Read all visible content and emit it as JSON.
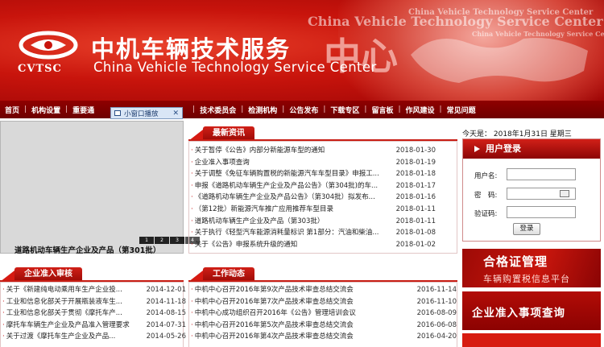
{
  "banner": {
    "logo_text": "CVTSC",
    "cn_title": "中机车辆技术服务",
    "big_char": "中心",
    "en_title": "China Vehicle Technology Service Center",
    "ghost_1": "China Vehicle Technology Service Center",
    "ghost_2": "China Vehicle Technology Service Center",
    "ghost_3": "China Vehicle Technology Service Center"
  },
  "nav": {
    "items_left": [
      "首页",
      "机构设置",
      "重要通"
    ],
    "items_right": [
      "技术委员会",
      "检测机构",
      "公告发布",
      "下载专区",
      "留言板",
      "作风建设",
      "常见问题"
    ]
  },
  "popup": {
    "label": "小窗口播放",
    "close": "✕"
  },
  "slideshow": {
    "caption": "道路机动车辆生产企业及产品（第301批）",
    "pages": [
      "1",
      "2",
      "3",
      "4"
    ]
  },
  "latest": {
    "title": "最新资讯",
    "items": [
      {
        "t": "关于暂停《公告》内部分新能源车型的通知",
        "d": "2018-01-30"
      },
      {
        "t": "企业准入事项查询",
        "d": "2018-01-19"
      },
      {
        "t": "关于调整《免征车辆购置税的新能源汽车车型目录》申报工...",
        "d": "2018-01-18"
      },
      {
        "t": "申报《道路机动车辆生产企业及产品公告》（第304批)的车...",
        "d": "2018-01-17"
      },
      {
        "t": "《道路机动车辆生产企业及产品公告》（第304批）拟发布...",
        "d": "2018-01-16"
      },
      {
        "t": "（第12批）新能源汽车推广应用推荐车型目录",
        "d": "2018-01-11"
      },
      {
        "t": "道路机动车辆生产企业及产品（第303批）",
        "d": "2018-01-11"
      },
      {
        "t": "关于执行《轻型汽车能源消耗量标识 第1部分：汽油和柴油...",
        "d": "2018-01-08"
      },
      {
        "t": "关于《公告》申报系统升级的通知",
        "d": "2018-01-02"
      }
    ]
  },
  "access": {
    "title": "企业准入审核",
    "items": [
      {
        "t": "关于《新建纯电动乘用车生产企业投...",
        "d": "2014-12-01"
      },
      {
        "t": "工业和信息化部关于开展瓶装液车生...",
        "d": "2014-11-18"
      },
      {
        "t": "工业和信息化部关于贯彻《摩托车产...",
        "d": "2014-08-15"
      },
      {
        "t": "摩托车车辆生产企业及产品准入管理要求",
        "d": "2014-07-31"
      },
      {
        "t": "关于过渡《摩托车生产企业及产品...",
        "d": "2014-05-26"
      }
    ]
  },
  "work": {
    "title": "工作动态",
    "items": [
      {
        "t": "中机中心召开2016年第9次产品技术审查总结交流会",
        "d": "2016-11-14"
      },
      {
        "t": "中机中心召开2016年第7次产品技术审查总结交流会",
        "d": "2016-11-10"
      },
      {
        "t": "中机中心成功组织召开2016年《公告》管理培训会议",
        "d": "2016-08-09"
      },
      {
        "t": "中机中心召开2016年第5次产品技术审查总结交流会",
        "d": "2016-06-08"
      },
      {
        "t": "中机中心召开2016年第4次产品技术审查总结交流会",
        "d": "2016-04-20"
      }
    ]
  },
  "today": "今天是： 2018年1月31日 星期三",
  "login": {
    "title": "用户登录",
    "user_label": "用户名:",
    "pass_label": "密　码:",
    "code_label": "验证码:",
    "button": "登录"
  },
  "ads": {
    "cert_1": "合格证管理",
    "cert_2": "车辆购置税信息平台",
    "query": "企业准入事项查询"
  },
  "colors": {
    "brand_red": "#c8140c",
    "nav_red": "#7e0000"
  }
}
